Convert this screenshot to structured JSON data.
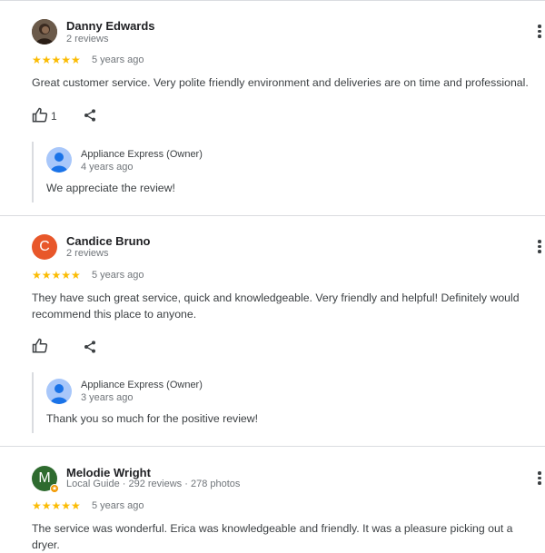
{
  "reviews": [
    {
      "author": "Danny Edwards",
      "meta": "2 reviews",
      "rating": "★★★★★",
      "time": "5 years ago",
      "text": "Great customer service. Very polite friendly environment and deliveries are on time and professional.",
      "likes": "1",
      "reply": {
        "owner": "Appliance Express (Owner)",
        "time": "4 years ago",
        "text": "We appreciate the review!"
      }
    },
    {
      "author": "Candice Bruno",
      "initial": "C",
      "meta": "2 reviews",
      "rating": "★★★★★",
      "time": "5 years ago",
      "text": "They have such great service, quick and knowledgeable. Very friendly and helpful! Definitely would recommend this place to anyone.",
      "reply": {
        "owner": "Appliance Express (Owner)",
        "time": "3 years ago",
        "text": "Thank you so much for the positive review!"
      }
    },
    {
      "author": "Melodie Wright",
      "initial": "M",
      "meta": "Local Guide · 292 reviews · 278 photos",
      "rating": "★★★★★",
      "time": "5 years ago",
      "text": "The service was wonderful. Erica was knowledgeable and friendly. It was a pleasure picking out a dryer."
    }
  ],
  "colors": {
    "star": "#fbbc04",
    "avatar_candice": "#e8572a",
    "avatar_melodie": "#2e6b2f",
    "owner_avatar": "#a8c7fa"
  },
  "icons": [
    "thumbs-up-icon",
    "share-icon",
    "more-vert-icon",
    "user-icon",
    "local-guide-badge-icon"
  ]
}
